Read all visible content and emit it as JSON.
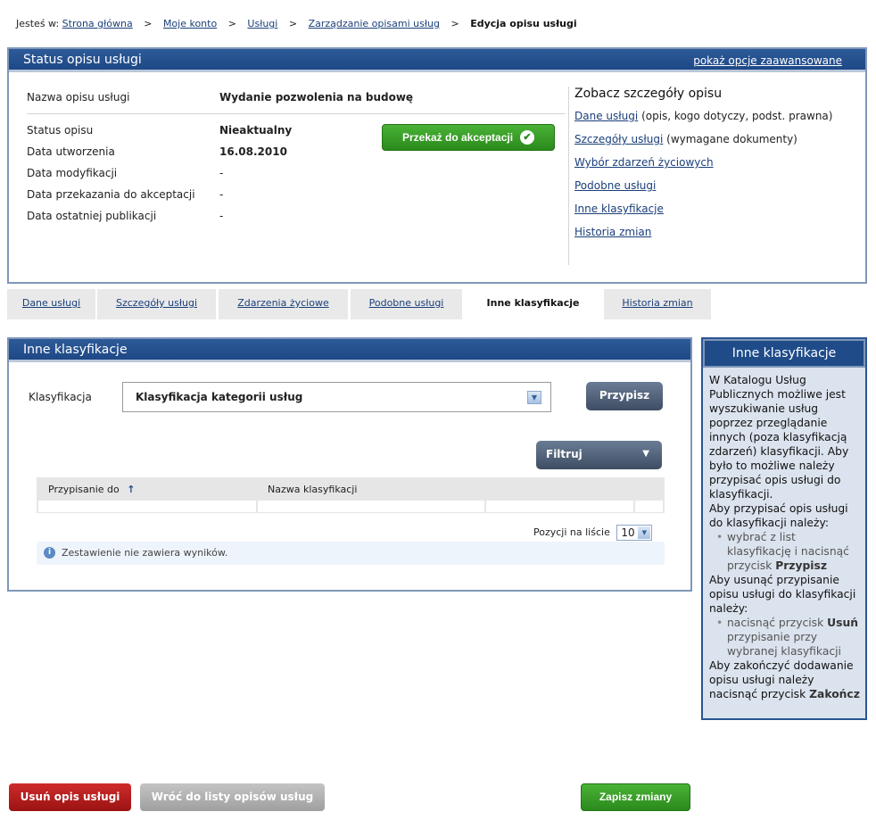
{
  "breadcrumb": {
    "prefix": "Jesteś w:",
    "items": [
      "Strona główna",
      "Moje konto",
      "Usługi",
      "Zarządzanie opisami usług"
    ],
    "current": "Edycja opisu usługi",
    "separator": ">"
  },
  "status_panel": {
    "title": "Status opisu usługi",
    "advanced_link": "pokaż opcje zaawansowane",
    "name_label": "Nazwa opisu usługi",
    "name_value": "Wydanie pozwolenia na budowę",
    "rows": [
      {
        "label": "Status opisu",
        "value": "Nieaktualny"
      },
      {
        "label": "Data utworzenia",
        "value": "16.08.2010"
      },
      {
        "label": "Data modyfikacji",
        "value": "-"
      },
      {
        "label": "Data przekazania do akceptacji",
        "value": "-"
      },
      {
        "label": "Data ostatniej publikacji",
        "value": "-"
      }
    ],
    "accept_button": "Przekaż do akceptacji",
    "details": {
      "title": "Zobacz szczegóły opisu",
      "items": [
        {
          "link": "Dane usługi",
          "note": "(opis, kogo dotyczy, podst. prawna)"
        },
        {
          "link": "Szczegóły usługi",
          "note": "(wymagane dokumenty)"
        },
        {
          "link": "Wybór zdarzeń życiowych",
          "note": ""
        },
        {
          "link": "Podobne usługi",
          "note": ""
        },
        {
          "link": "Inne klasyfikacje",
          "note": ""
        },
        {
          "link": "Historia zmian",
          "note": ""
        }
      ]
    }
  },
  "tabs": [
    "Dane usługi",
    "Szczegóły usługi",
    "Zdarzenia życiowe",
    "Podobne usługi",
    "Inne klasyfikacje",
    "Historia zmian"
  ],
  "active_tab": "Inne klasyfikacje",
  "classification_panel": {
    "title": "Inne klasyfikacje",
    "field_label": "Klasyfikacja",
    "selected_value": "Klasyfikacja kategorii usług",
    "assign_button": "Przypisz",
    "filter_button": "Filtruj",
    "table_headers": [
      "Przypisanie do",
      "Nazwa klasyfikacji"
    ],
    "sort_indicator": "↑",
    "page_size_label": "Pozycji na liście",
    "page_size_value": "10",
    "empty_message": "Zestawienie nie zawiera wyników."
  },
  "help_panel": {
    "title": "Inne klasyfikacje",
    "intro": "W Katalogu Usług Publicznych możliwe jest wyszukiwanie usług poprzez przeglądanie innych (poza klasyfikacją zdarzeń) klasyfikacji. Aby było to możliwe należy przypisać opis usługi do klasyfikacji.",
    "assign_intro": "Aby przypisać opis usługi do klasyfikacji należy:",
    "assign_step_text": "wybrać z list klasyfikację i nacisnąć przycisk",
    "assign_step_bold": "Przypisz",
    "remove_intro": "Aby usunąć przypisanie opisu usługi do klasyfikacji należy:",
    "remove_step_text1": "nacisnąć przycisk",
    "remove_step_bold": "Usuń",
    "remove_step_text2": "przypisanie przy wybranej klasyfikacji",
    "finish_text": "Aby zakończyć dodawanie opisu usługi należy nacisnąć przycisk",
    "finish_bold": "Zakończ"
  },
  "footer": {
    "delete_button": "Usuń opis usługi",
    "back_button": "Wróć do listy opisów usług",
    "save_button": "Zapisz zmiany"
  },
  "colors": {
    "header_blue": "#1e4886",
    "accent_green": "#2a8a1c",
    "danger_red": "#9a1313"
  }
}
